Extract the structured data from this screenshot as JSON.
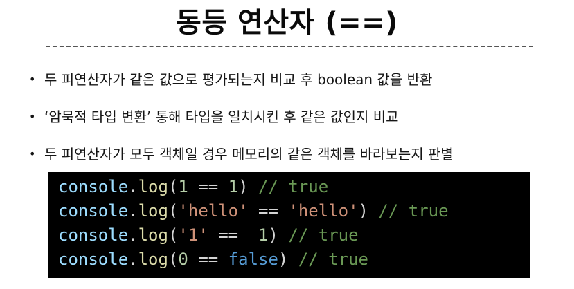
{
  "title": "동등 연산자 (==)",
  "bullets": [
    "두 피연산자가 같은 값으로 평가되는지 비교 후 boolean 값을 반환",
    "‘암묵적 타입 변환’ 통해 타입을 일치시킨 후 같은 값인지 비교",
    "두 피연산자가 모두 객체일 경우 메모리의 같은 객체를 바라보는지 판별"
  ],
  "bullet_glyph": "•",
  "code": {
    "lines": [
      {
        "obj": "console",
        "dot": ".",
        "fn": "log",
        "open": "(",
        "left": "1",
        "op": " == ",
        "right": "1",
        "close": ")",
        "comment": " // true"
      },
      {
        "obj": "console",
        "dot": ".",
        "fn": "log",
        "open": "(",
        "left": "'hello'",
        "op": " == ",
        "right": "'hello'",
        "close": ")",
        "comment": " // true"
      },
      {
        "obj": "console",
        "dot": ".",
        "fn": "log",
        "open": "(",
        "left": "'1'",
        "op": " ==  ",
        "right": "1",
        "close": ")",
        "comment": " // true"
      },
      {
        "obj": "console",
        "dot": ".",
        "fn": "log",
        "open": "(",
        "left": "0",
        "op": " == ",
        "right": "false",
        "close": ")",
        "comment": " // true"
      }
    ]
  },
  "colors": {
    "code_background": "#000000",
    "identifier": "#9cdcfe",
    "function": "#dcdcaa",
    "number": "#b5cea8",
    "string": "#ce9178",
    "keyword": "#569cd6",
    "comment": "#6a9955"
  }
}
